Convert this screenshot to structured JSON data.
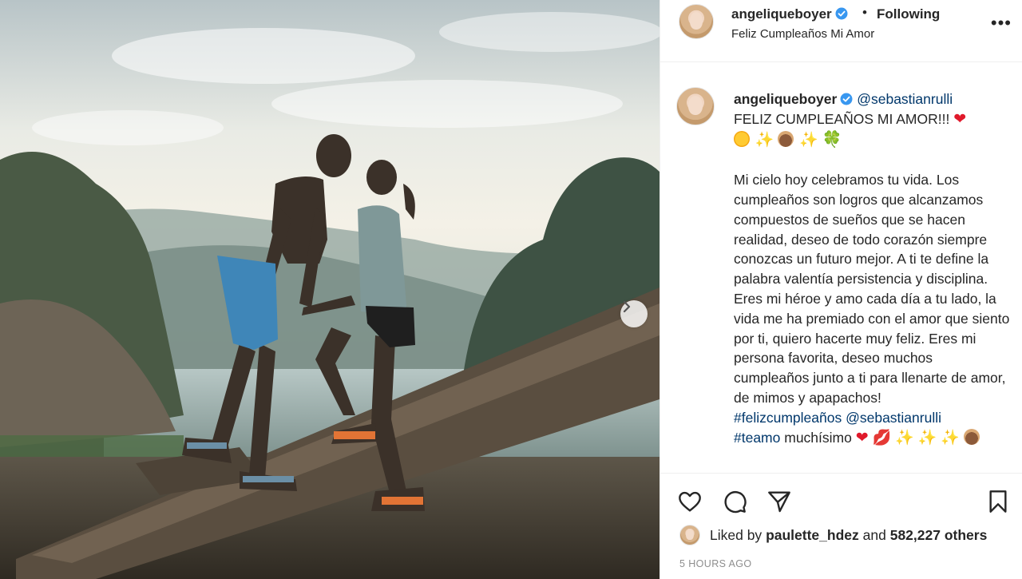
{
  "header": {
    "username": "angeliqueboyer",
    "separator": "•",
    "follow_label": "Following",
    "location": "Feliz Cumpleaños Mi Amor",
    "more_label": "•••"
  },
  "caption": {
    "username": "angeliqueboyer",
    "mention": "@sebastianrulli",
    "headline": "FELIZ CUMPLEAÑOS MI AMOR!!!",
    "body": "Mi cielo hoy celebramos tu vida. Los cumpleaños son logros que alcanzamos compuestos de sueños que se hacen realidad, deseo de todo corazón siempre conozcas un futuro mejor. A ti te define la palabra valentía persistencia y disciplina. Eres mi héroe y amo cada día a tu lado, la vida me ha premiado con el amor que siento por ti, quiero hacerte muy feliz. Eres mi persona favorita, deseo muchos cumpleaños junto a ti para llenarte de amor, de mimos y apapachos!",
    "hashtag1": "#felizcumpleaños",
    "mention2": "@sebastianrulli",
    "hashtag2": "#teamo",
    "trailing": "muchísimo"
  },
  "emojis": {
    "heart": "❤",
    "sparkles": "✨",
    "clover": "🍀",
    "lips": "💋"
  },
  "likes": {
    "prefix": "Liked by",
    "user": "paulette_hdez",
    "middle": "and",
    "count": "582,227 others"
  },
  "timestamp": "5 HOURS AGO",
  "icons": {
    "like": "heart-outline-icon",
    "comment": "speech-bubble-icon",
    "share": "paper-plane-icon",
    "save": "bookmark-icon",
    "next": "chevron-right-icon",
    "verified": "verified-badge-icon"
  },
  "colors": {
    "link": "#00376b",
    "verified": "#3897f0",
    "muted": "#8e8e8e",
    "text": "#262626"
  }
}
